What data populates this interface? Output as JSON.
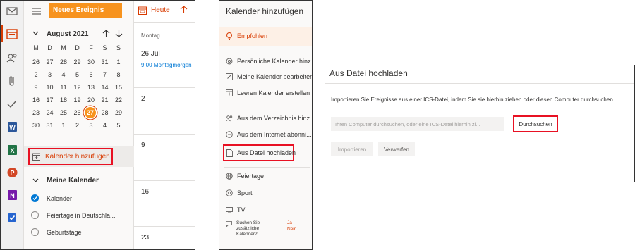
{
  "panel1": {
    "new_event_label": "Neues Ereignis",
    "today_label": "Heute",
    "month_label": "August 2021",
    "weekdays": [
      "M",
      "D",
      "M",
      "D",
      "F",
      "S",
      "S"
    ],
    "weeks": [
      [
        "26",
        "27",
        "28",
        "29",
        "30",
        "31",
        "1"
      ],
      [
        "2",
        "3",
        "4",
        "5",
        "6",
        "7",
        "8"
      ],
      [
        "9",
        "10",
        "11",
        "12",
        "13",
        "14",
        "15"
      ],
      [
        "16",
        "17",
        "18",
        "19",
        "20",
        "21",
        "22"
      ],
      [
        "23",
        "24",
        "25",
        "26",
        "27",
        "28",
        "29"
      ],
      [
        "30",
        "31",
        "1",
        "2",
        "3",
        "4",
        "5"
      ]
    ],
    "add_calendar_label": "Kalender hinzufügen",
    "my_calendars_label": "Meine Kalender",
    "calendars": [
      "Kalender",
      "Feiertage in Deutschla...",
      "Geburtstage"
    ],
    "day_header": "Montag",
    "day_cells": [
      "26 Jul",
      "2",
      "9",
      "16",
      "23"
    ],
    "event_label": "9:00 Montagmorgen",
    "colors": {
      "accent": "#d83b01",
      "orange_button": "#f7931e",
      "today_circle": "#f7931e",
      "highlight": "#e81123"
    }
  },
  "panel2": {
    "title": "Kalender hinzufügen",
    "items": [
      {
        "label": "Empfohlen",
        "icon": "lightbulb-icon"
      },
      {
        "label": "Persönliche Kalender hinz...",
        "icon": "at-icon"
      },
      {
        "label": "Meine Kalender bearbeiten",
        "icon": "edit-calendar-icon"
      },
      {
        "label": "Leeren Kalender erstellen",
        "icon": "new-calendar-icon"
      },
      {
        "label": "Aus dem Verzeichnis hinz...",
        "icon": "people-icon"
      },
      {
        "label": "Aus dem Internet abonni...",
        "icon": "link-icon"
      },
      {
        "label": "Aus Datei hochladen",
        "icon": "file-upload-icon"
      },
      {
        "label": "Feiertage",
        "icon": "globe-icon"
      },
      {
        "label": "Sport",
        "icon": "ball-icon"
      },
      {
        "label": "TV",
        "icon": "tv-icon"
      }
    ],
    "feedback_question": "Suchen Sie zusätzliche Kalender?",
    "feedback_yes": "Ja",
    "feedback_no": "Nein"
  },
  "panel3": {
    "title": "Aus Datei hochladen",
    "description": "Importieren Sie Ereignisse aus einer ICS-Datei, indem Sie sie hierhin ziehen oder diesen Computer durchsuchen.",
    "file_placeholder": "Ihren Computer durchsuchen, oder eine ICS-Datei hierhin zi...",
    "browse_label": "Durchsuchen",
    "import_label": "Importieren",
    "discard_label": "Verwerfen"
  }
}
